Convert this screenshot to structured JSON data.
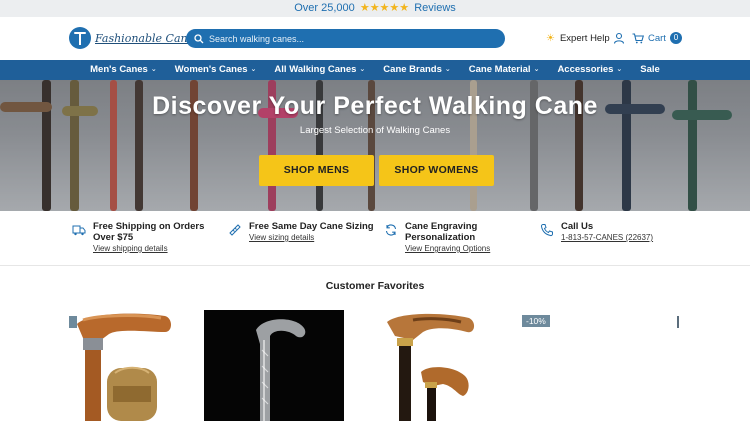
{
  "topbar": {
    "prefix": "Over 25,000",
    "stars": "★★★★★",
    "suffix": "Reviews"
  },
  "header": {
    "logo_text": "Fashionable Canes",
    "search_placeholder": "Search walking canes...",
    "expert_help": "Expert Help",
    "cart_label": "Cart",
    "cart_count": "0"
  },
  "nav": {
    "items": [
      {
        "label": "Men's Canes",
        "has_dropdown": true
      },
      {
        "label": "Women's Canes",
        "has_dropdown": true
      },
      {
        "label": "All Walking Canes",
        "has_dropdown": true
      },
      {
        "label": "Cane Brands",
        "has_dropdown": true
      },
      {
        "label": "Cane Material",
        "has_dropdown": true
      },
      {
        "label": "Accessories",
        "has_dropdown": true
      },
      {
        "label": "Sale",
        "has_dropdown": false
      }
    ],
    "chevron": "⌄"
  },
  "hero": {
    "title": "Discover Your Perfect Walking Cane",
    "subtitle": "Largest Selection of Walking Canes",
    "btn_mens": "SHOP MENS",
    "btn_womens": "SHOP WOMENS"
  },
  "features": [
    {
      "icon": "shipping-icon",
      "title_line1": "Free Shipping on Orders",
      "title_line2": "Over $75",
      "link": "View shipping details"
    },
    {
      "icon": "ruler-icon",
      "title_line1": "Free Same Day Cane Sizing",
      "title_line2": "",
      "link": "View sizing details"
    },
    {
      "icon": "refresh-icon",
      "title_line1": "Cane Engraving",
      "title_line2": "Personalization",
      "link": "View Engraving Options"
    },
    {
      "icon": "phone-icon",
      "title_line1": "Call Us",
      "title_line2": "",
      "link": "1-813-57-CANES (22637)"
    }
  ],
  "favorites": {
    "title": "Customer Favorites",
    "discount_badge": "-10%"
  },
  "colors": {
    "brand_blue": "#1f6fb0",
    "nav_blue": "#1f5f99",
    "cta_yellow": "#f5c518",
    "star_gold": "#f2b51d"
  }
}
